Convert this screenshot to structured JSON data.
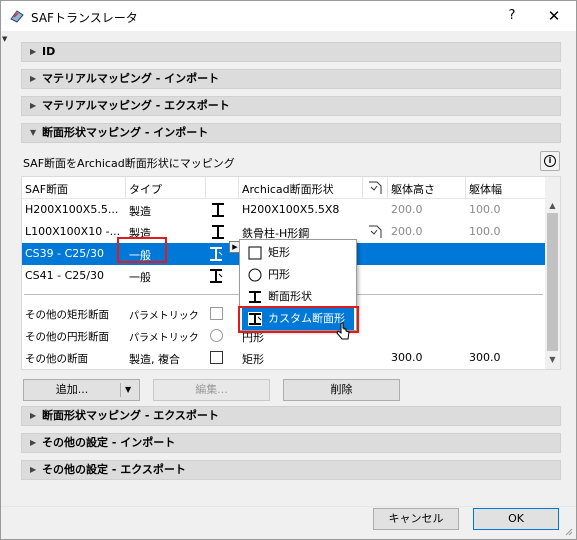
{
  "window": {
    "title": "SAFトランスレータ",
    "help": "?",
    "close": "✕"
  },
  "sections_top": [
    {
      "label": "ID",
      "expanded": false
    },
    {
      "label": "マテリアルマッピング - インポート",
      "expanded": false
    },
    {
      "label": "マテリアルマッピング - エクスポート",
      "expanded": false
    },
    {
      "label": "断面形状マッピング - インポート",
      "expanded": true
    }
  ],
  "mapping": {
    "description": "SAF断面をArchicad断面形状にマッピング",
    "info_icon": "i",
    "columns": [
      "SAF断面",
      "タイプ",
      "",
      "Archicad断面形状",
      "",
      "躯体高さ",
      "躯体幅"
    ],
    "rows": [
      {
        "saf": "H200X100X5.5...",
        "type": "製造",
        "archicad": "H200X100X5.5X8",
        "height": "200.0",
        "width": "100.0"
      },
      {
        "saf": "L100X100X10 -...",
        "type": "製造",
        "archicad": "鉄骨柱-H形鋼",
        "height": "200.0",
        "width": "100.0"
      },
      {
        "saf": "CS39 - C25/30",
        "type": "一般",
        "archicad": "",
        "height": "",
        "width": ""
      },
      {
        "saf": "CS41 - C25/30",
        "type": "一般",
        "archicad": "",
        "height": "",
        "width": ""
      }
    ],
    "other_rows": [
      {
        "label": "その他の矩形断面",
        "type": "パラメトリック",
        "archicad": "",
        "height": "",
        "width": ""
      },
      {
        "label": "その他の円形断面",
        "type": "パラメトリック",
        "archicad": "円形",
        "height": "",
        "width": ""
      },
      {
        "label": "その他の断面",
        "type": "製造, 複合",
        "archicad": "矩形",
        "height": "300.0",
        "width": "300.0"
      }
    ]
  },
  "dropdown": {
    "items": [
      "矩形",
      "円形",
      "断面形状",
      "カスタム断面形状"
    ],
    "highlighted": "カスタム断面形状"
  },
  "actions": {
    "add": "追加...",
    "edit": "編集...",
    "delete": "削除"
  },
  "sections_bottom": [
    {
      "label": "断面形状マッピング - エクスポート",
      "expanded": false
    },
    {
      "label": "その他の設定 - インポート",
      "expanded": false
    },
    {
      "label": "その他の設定 - エクスポート",
      "expanded": false
    }
  ],
  "footer": {
    "cancel": "キャンセル",
    "ok": "OK"
  },
  "colors": {
    "selection": "#0078d7",
    "highlight_box": "#e11b1b"
  }
}
